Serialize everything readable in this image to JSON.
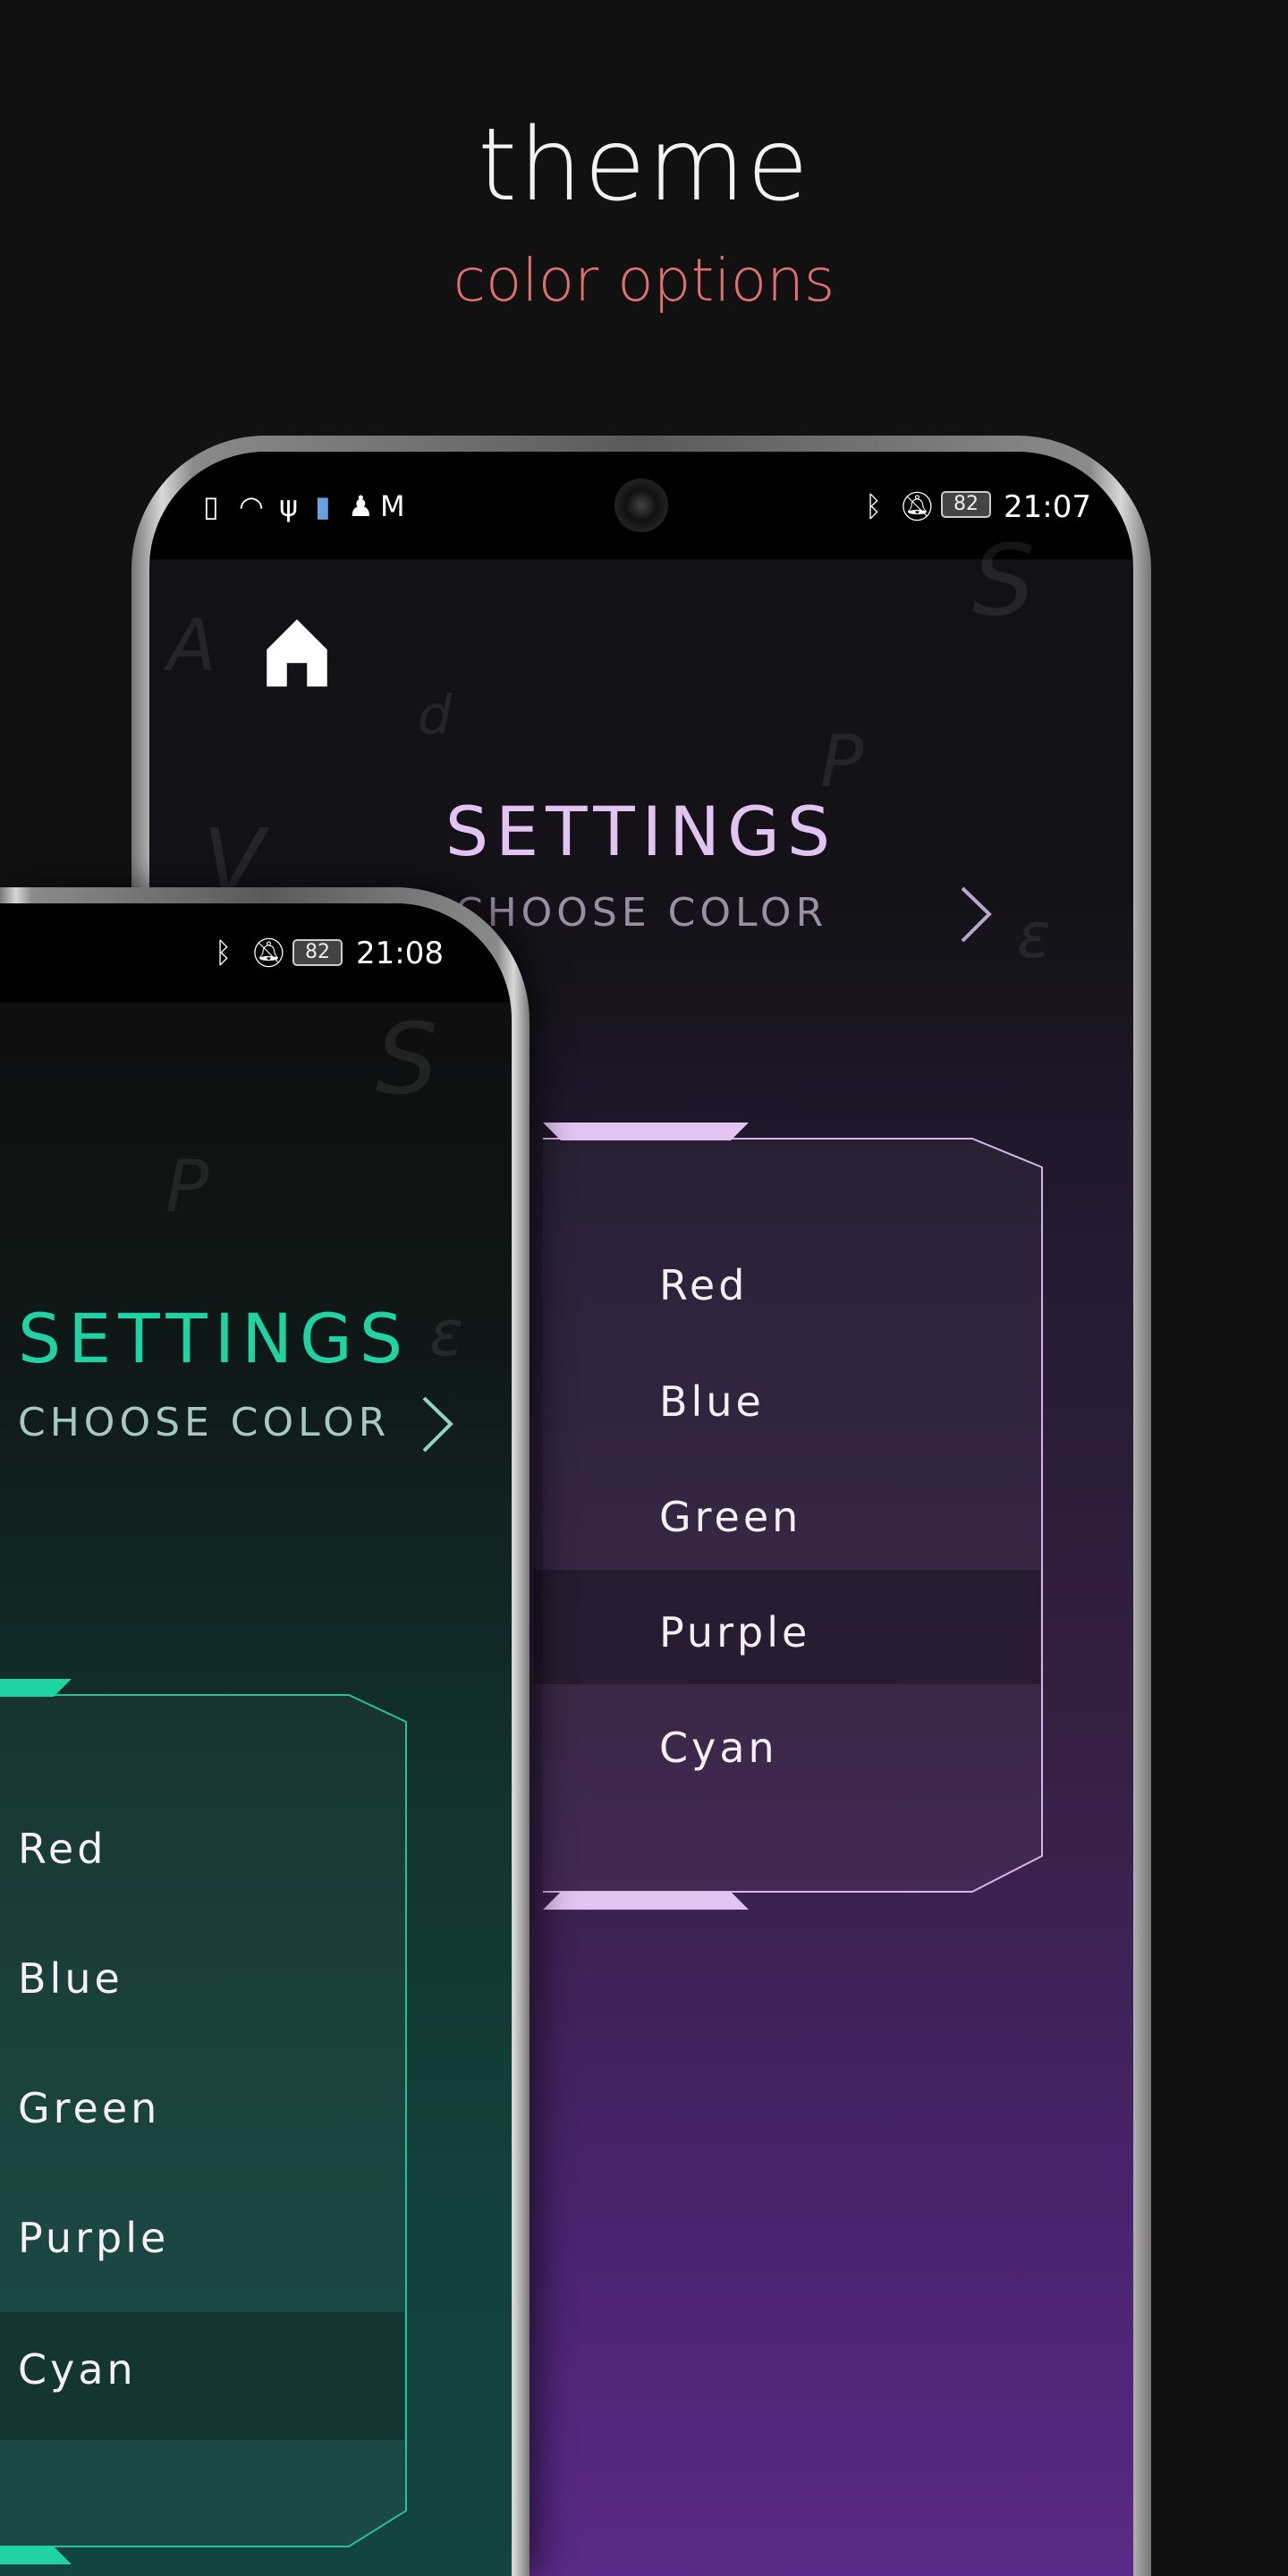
{
  "header": {
    "title": "theme",
    "subtitle": "color options"
  },
  "colors": {
    "subtitle": "#e07070",
    "purple_accent": "#e2c4f2",
    "teal_accent": "#1fd3a2",
    "background": "#111111"
  },
  "back_phone": {
    "status": {
      "time": "21:07",
      "battery": "82",
      "left_icons": [
        "sim-alert-icon",
        "wifi-icon",
        "usb-icon",
        "battery-saver-icon",
        "keyhole-icon",
        "gmail-icon"
      ],
      "right_icons": [
        "bluetooth-icon",
        "bell-off-icon"
      ]
    },
    "home_icon": "home-icon",
    "title": "SETTINGS",
    "subtitle": "CHOOSE COLOR",
    "options": [
      "Red",
      "Blue",
      "Green",
      "Purple",
      "Cyan"
    ],
    "selected": "Purple"
  },
  "front_phone": {
    "status": {
      "time": "21:08",
      "battery": "82",
      "right_icons": [
        "bluetooth-icon",
        "bell-off-icon"
      ]
    },
    "title": "SETTINGS",
    "subtitle": "CHOOSE COLOR",
    "options": [
      "Red",
      "Blue",
      "Green",
      "Purple",
      "Cyan"
    ],
    "selected": "Cyan"
  }
}
